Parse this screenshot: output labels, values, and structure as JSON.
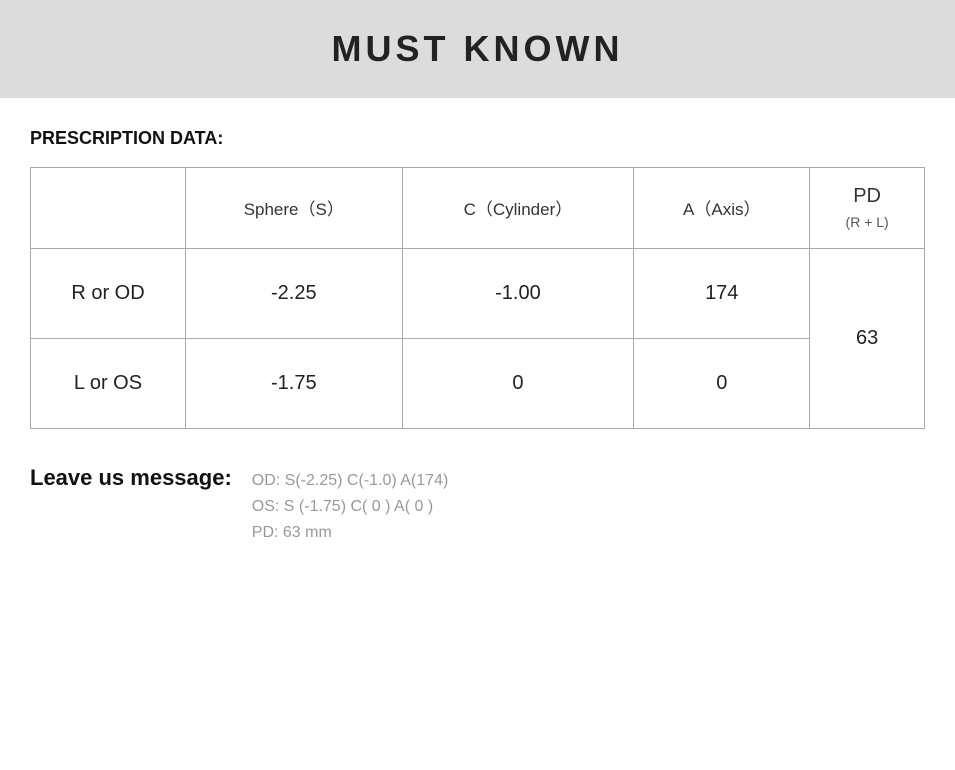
{
  "header": {
    "title": "MUST KNOWN"
  },
  "prescription": {
    "section_label": "PRESCRIPTION DATA:",
    "columns": {
      "empty": "",
      "sphere": "Sphere（S）",
      "cylinder": "C（Cylinder）",
      "axis": "A（Axis）",
      "pd_main": "PD",
      "pd_sub": "(R + L)"
    },
    "rows": [
      {
        "label": "R or OD",
        "sphere": "-2.25",
        "cylinder": "-1.00",
        "axis": "174"
      },
      {
        "label": "L or OS",
        "sphere": "-1.75",
        "cylinder": "0",
        "axis": "0"
      }
    ],
    "pd_value": "63"
  },
  "message": {
    "label": "Leave us message:",
    "lines": [
      "OD:  S(-2.25)    C(-1.0)   A(174)",
      "OS:  S (-1.75)    C( 0 )    A( 0 )",
      "PD:  63 mm"
    ]
  }
}
